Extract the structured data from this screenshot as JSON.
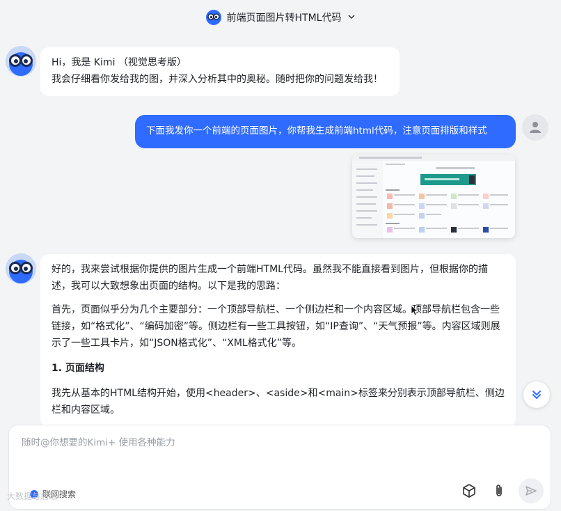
{
  "header": {
    "title": "前端页面图片转HTML代码"
  },
  "greeting": {
    "line1": "Hi，我是 Kimi （视觉思考版）",
    "line2": "我会仔细看你发给我的图，并深入分析其中的奥秘。随时把你的问题发给我！"
  },
  "user_message": {
    "text": "下面我发你一个前端的页面图片，你帮我生成前端html代码，注意页面排版和样式"
  },
  "reply": {
    "p1": "好的，我来尝试根据你提供的图片生成一个前端HTML代码。虽然我不能直接看到图片，但根据你的描述，我可以大致想象出页面的结构。以下是我的思路：",
    "p2": "首先，页面似乎分为几个主要部分：一个顶部导航栏、一个侧边栏和一个内容区域。顶部导航栏包含一些链接，如“格式化”、“编码加密”等。侧边栏有一些工具按钮，如“IP查询”、“天气预报”等。内容区域则展示了一些工具卡片，如“JSON格式化”、“XML格式化”等。",
    "h1": "1. 页面结构",
    "p3": "我先从基本的HTML结构开始，使用<header>、<aside>和<main>标签来分别表示顶部导航栏、侧边栏和内容区域。"
  },
  "input": {
    "placeholder": "随时@你想要的Kimi+ 使用各种能力"
  },
  "net_search": {
    "label": "联网搜索"
  },
  "watermark": {
    "text": "大数据与后端"
  },
  "colors": {
    "accent": "#2f6bff",
    "background": "#f3f4f6",
    "bubble": "#ffffff"
  },
  "icons": [
    "kimi-logo-icon",
    "chevron-down-icon",
    "user-icon",
    "chevrons-down-icon",
    "cube-icon",
    "paperclip-icon",
    "send-icon"
  ]
}
